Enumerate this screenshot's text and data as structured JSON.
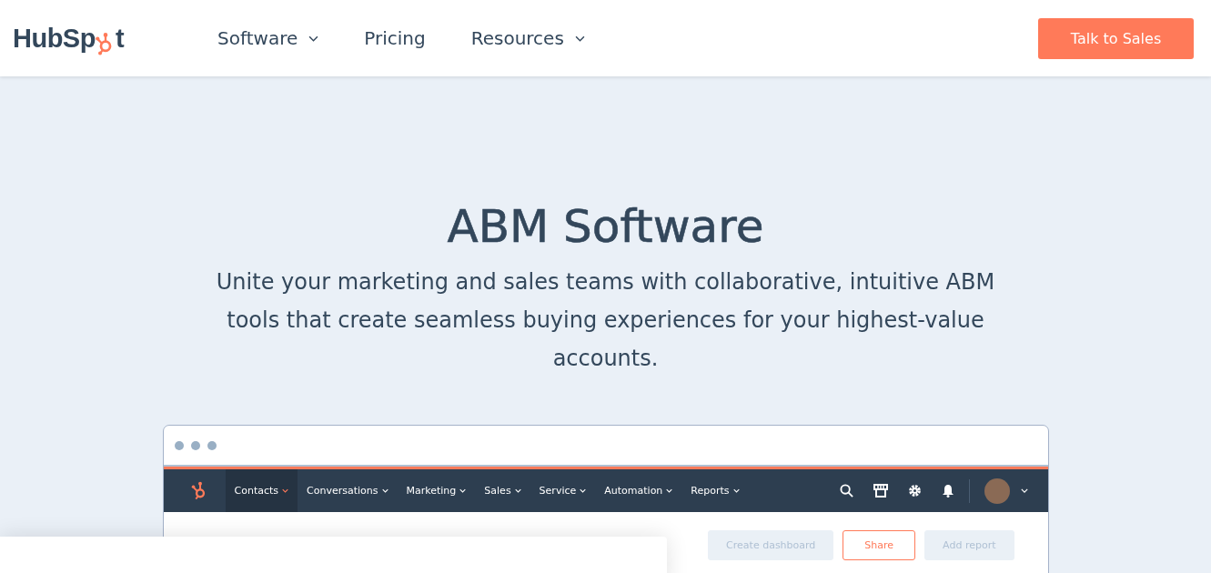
{
  "header": {
    "logo": {
      "before": "HubSp",
      "after": "t"
    },
    "nav": [
      {
        "label": "Software",
        "dropdown": true
      },
      {
        "label": "Pricing",
        "dropdown": false
      },
      {
        "label": "Resources",
        "dropdown": true
      }
    ],
    "cta": "Talk to Sales"
  },
  "hero": {
    "title": "ABM Software",
    "subtitle": "Unite your marketing and sales teams with collaborative, intuitive ABM tools that create seamless buying experiences for your highest-value accounts."
  },
  "app_preview": {
    "nav": [
      {
        "label": "Contacts",
        "selected": true
      },
      {
        "label": "Conversations",
        "selected": false
      },
      {
        "label": "Marketing",
        "selected": false
      },
      {
        "label": "Sales",
        "selected": false
      },
      {
        "label": "Service",
        "selected": false
      },
      {
        "label": "Automation",
        "selected": false
      },
      {
        "label": "Reports",
        "selected": false
      }
    ],
    "buttons": [
      {
        "label": "Create dashboard",
        "kind": "muted"
      },
      {
        "label": "Share",
        "kind": "outline"
      },
      {
        "label": "Add report",
        "kind": "muted"
      }
    ]
  }
}
